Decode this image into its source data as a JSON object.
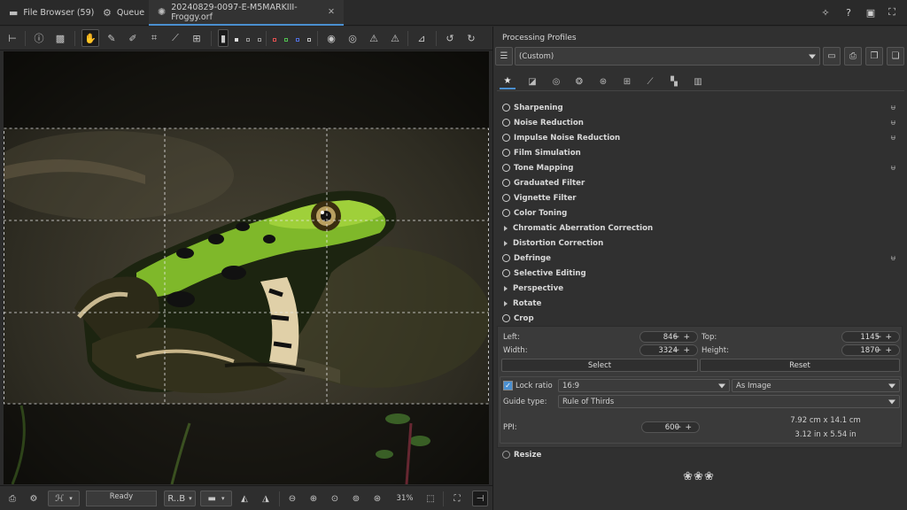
{
  "tabs": [
    {
      "label": "File Browser (59)",
      "icon": "folder-icon"
    },
    {
      "label": "Queue",
      "icon": "gear-icon"
    },
    {
      "label": "20240829-0097-E-M5MARKIII-Froggy.orf",
      "icon": "aperture-icon"
    }
  ],
  "panel": {
    "title": "Processing Profiles",
    "profile_value": "(Custom)",
    "tools": [
      {
        "label": "Sharpening",
        "marker": "power",
        "reset": true
      },
      {
        "label": "Noise Reduction",
        "marker": "power",
        "reset": true
      },
      {
        "label": "Impulse Noise Reduction",
        "marker": "power",
        "reset": true
      },
      {
        "label": "Film Simulation",
        "marker": "power",
        "reset": false
      },
      {
        "label": "Tone Mapping",
        "marker": "power",
        "reset": true
      },
      {
        "label": "Graduated Filter",
        "marker": "power",
        "reset": false
      },
      {
        "label": "Vignette Filter",
        "marker": "power",
        "reset": false
      },
      {
        "label": "Color Toning",
        "marker": "power",
        "reset": false
      },
      {
        "label": "Chromatic Aberration Correction",
        "marker": "expand",
        "reset": false
      },
      {
        "label": "Distortion Correction",
        "marker": "expand",
        "reset": false
      },
      {
        "label": "Defringe",
        "marker": "power",
        "reset": true
      },
      {
        "label": "Selective Editing",
        "marker": "power",
        "reset": false
      },
      {
        "label": "Perspective",
        "marker": "expand",
        "reset": false
      },
      {
        "label": "Rotate",
        "marker": "expand",
        "reset": false
      },
      {
        "label": "Crop",
        "marker": "power",
        "reset": false
      }
    ],
    "crop": {
      "left_label": "Left:",
      "left_value": "846",
      "top_label": "Top:",
      "top_value": "1145",
      "width_label": "Width:",
      "width_value": "3324",
      "height_label": "Height:",
      "height_value": "1870",
      "select_label": "Select",
      "reset_label": "Reset",
      "lock_ratio_label": "Lock ratio",
      "ratio_value": "16:9",
      "orientation_value": "As Image",
      "guide_label": "Guide type:",
      "guide_value": "Rule of Thirds",
      "ppi_label": "PPI:",
      "ppi_value": "600",
      "size_cm": "7.92 cm x 14.1 cm",
      "size_in": "3.12 in x 5.54 in"
    },
    "resize_label": "Resize"
  },
  "bottombar": {
    "status": "Ready",
    "channel_value": "R..B",
    "zoom": "31%"
  },
  "icons": {
    "reset": "Ʉ",
    "ornament": "❀❀❀"
  }
}
